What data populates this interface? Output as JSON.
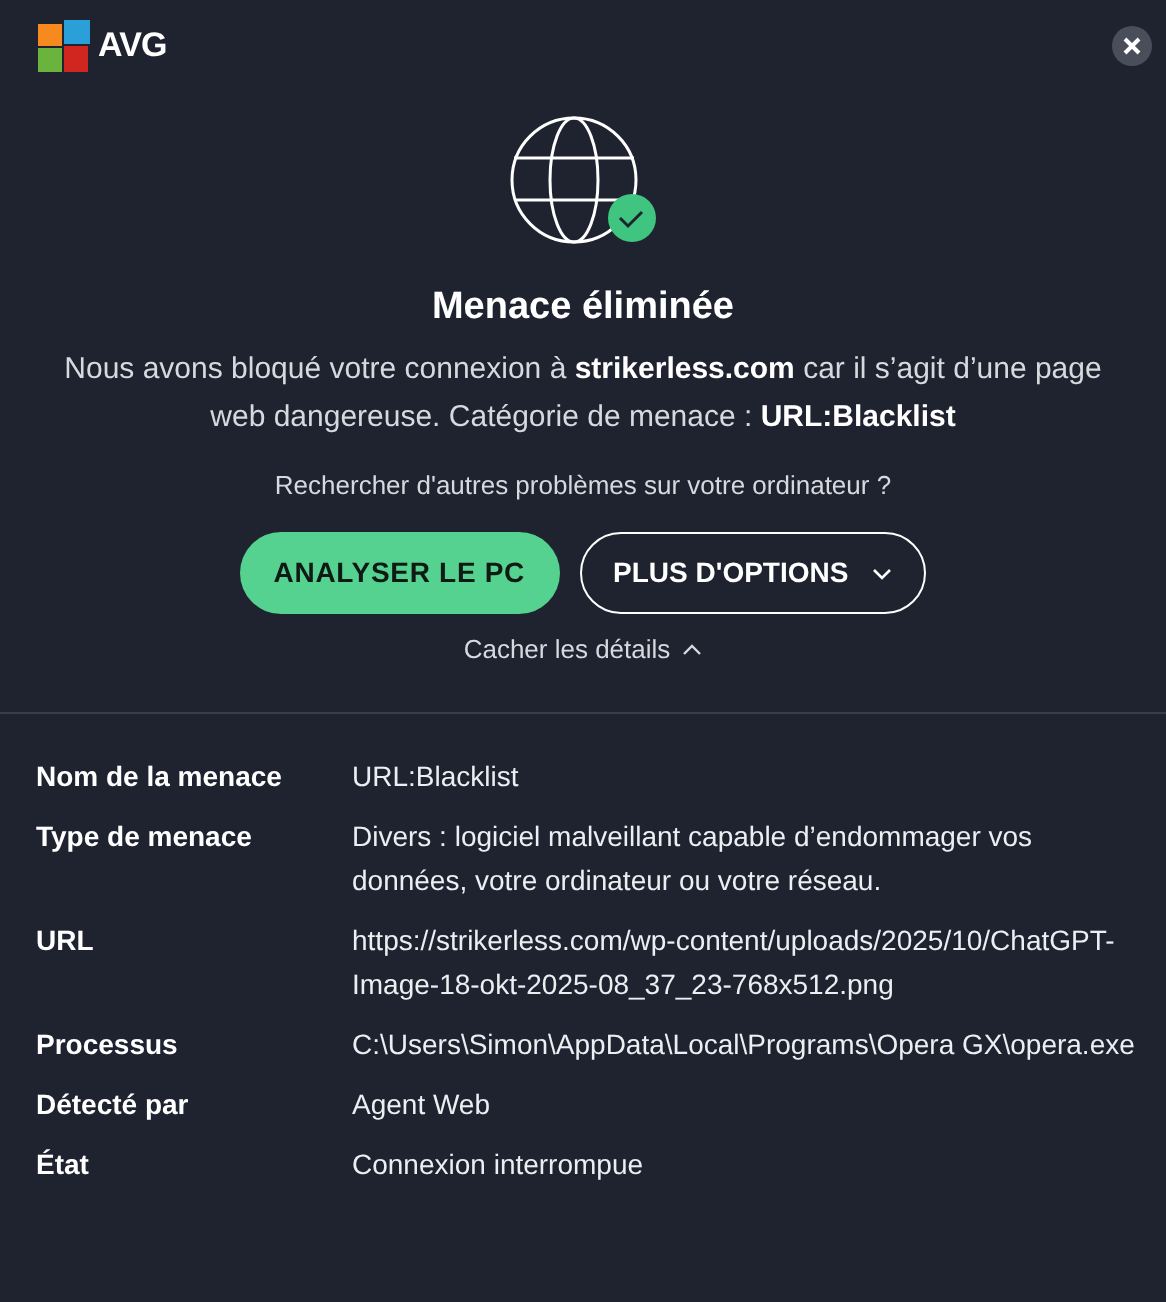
{
  "brand": {
    "name": "AVG"
  },
  "status": {
    "resolved": true
  },
  "title": "Menace éliminée",
  "message": "Nous avons bloqué votre connexion à **strikerless.com** car il s’agit d’une page web dangereuse. Catégorie de menace : **URL:Blacklist**",
  "prompt": "Rechercher d'autres problèmes sur votre ordinateur ?",
  "buttons": [
    {
      "kind": "primary",
      "label": "ANALYSER LE PC"
    },
    {
      "kind": "dropdown",
      "label": "PLUS D'OPTIONS"
    }
  ],
  "details_toggle": {
    "label": "Cacher les détails",
    "expanded": true
  },
  "details": [
    {
      "label": "Nom de la menace",
      "value": "URL:Blacklist"
    },
    {
      "label": "Type de menace",
      "value": "Divers : logiciel malveillant capable d’endommager vos données, votre ordinateur ou votre réseau."
    },
    {
      "label": "URL",
      "value": "https://strikerless.com/wp-content/uploads/2025/10/ChatGPT-Image-18-okt-2025-08_37_23-768x512.png"
    },
    {
      "label": "Processus",
      "value": "C:\\Users\\Simon\\AppData\\Local\\Programs\\Opera GX\\opera.exe"
    },
    {
      "label": "Détecté par",
      "value": "Agent Web"
    },
    {
      "label": "État",
      "value": "Connexion interrompue"
    }
  ]
}
